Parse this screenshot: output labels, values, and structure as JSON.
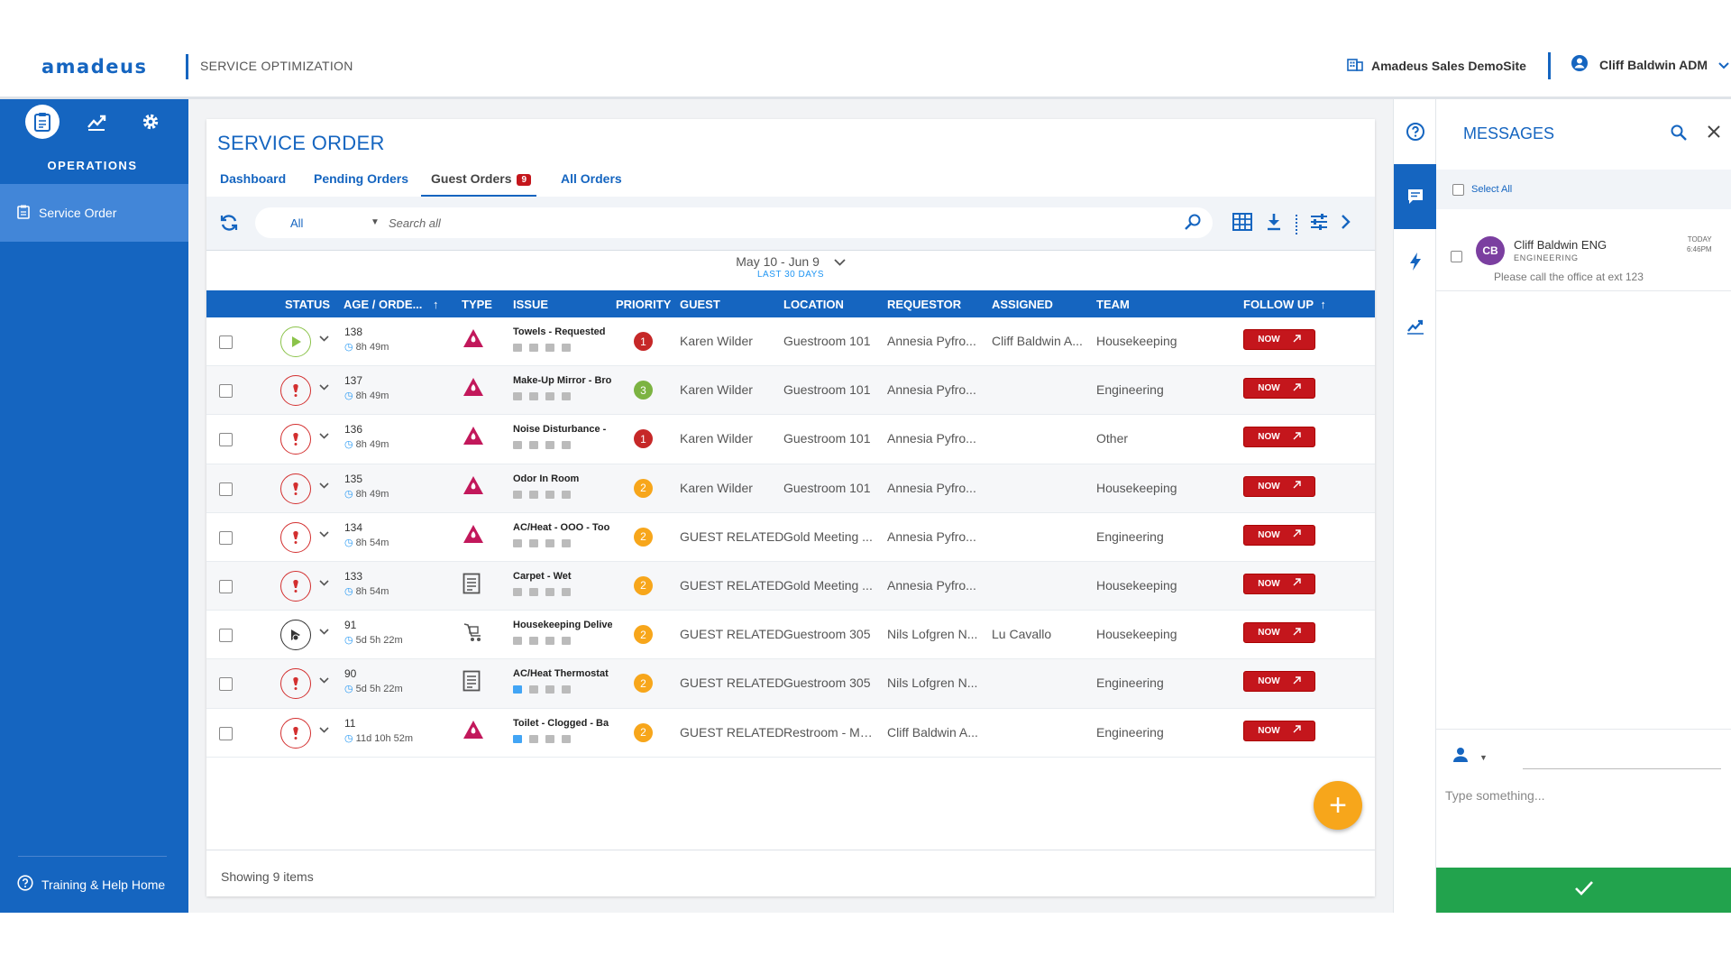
{
  "header": {
    "logo": "amadeus",
    "app_title": "SERVICE OPTIMIZATION",
    "site_name": "Amadeus Sales DemoSite",
    "user_name": "Cliff Baldwin ADM"
  },
  "nav": {
    "section_title": "OPERATIONS",
    "items": [
      {
        "label": "Service Order"
      }
    ],
    "help_label": "Training & Help Home"
  },
  "page": {
    "title": "SERVICE ORDER",
    "tabs": [
      {
        "label": "Dashboard"
      },
      {
        "label": "Pending Orders"
      },
      {
        "label": "Guest Orders",
        "badge": "9"
      },
      {
        "label": "All Orders"
      }
    ],
    "active_tab": "Guest Orders"
  },
  "toolbar": {
    "filter_value": "All",
    "search_placeholder": "Search all"
  },
  "date_range": {
    "range": "May 10 - Jun 9",
    "caption": "LAST 30 DAYS"
  },
  "table": {
    "columns": [
      "STATUS",
      "AGE / ORDE...",
      "TYPE",
      "ISSUE",
      "PRIORITY",
      "GUEST",
      "LOCATION",
      "REQUESTOR",
      "ASSIGNED",
      "TEAM",
      "FOLLOW UP"
    ],
    "sort_arrow": "↑",
    "follow_label": "NOW",
    "rows": [
      {
        "status": "play",
        "order": "138",
        "age": "8h 49m",
        "type": "alert",
        "issue": "Towels - Requested",
        "priority": "1",
        "guest": "Karen Wilder",
        "location": "Guestroom 101",
        "requestor": "Annesia Pyfro...",
        "assigned": "Cliff Baldwin A...",
        "team": "Housekeeping"
      },
      {
        "status": "alert",
        "order": "137",
        "age": "8h 49m",
        "type": "alert",
        "issue": "Make-Up Mirror - Broken",
        "priority": "3",
        "guest": "Karen Wilder",
        "location": "Guestroom 101",
        "requestor": "Annesia Pyfro...",
        "assigned": "",
        "team": "Engineering"
      },
      {
        "status": "alert",
        "order": "136",
        "age": "8h 49m",
        "type": "alert",
        "issue": "Noise Disturbance - ",
        "priority": "1",
        "guest": "Karen Wilder",
        "location": "Guestroom 101",
        "requestor": "Annesia Pyfro...",
        "assigned": "",
        "team": "Other"
      },
      {
        "status": "alert",
        "order": "135",
        "age": "8h 49m",
        "type": "alert",
        "issue": "Odor In Room",
        "priority": "2",
        "guest": "Karen Wilder",
        "location": "Guestroom 101",
        "requestor": "Annesia Pyfro...",
        "assigned": "",
        "team": "Housekeeping"
      },
      {
        "status": "alert",
        "order": "134",
        "age": "8h 54m",
        "type": "alert",
        "issue": "AC/Heat - OOO - Too",
        "priority": "2",
        "guest": "GUEST RELATED",
        "location": "Gold Meeting ...",
        "requestor": "Annesia Pyfro...",
        "assigned": "",
        "team": "Engineering"
      },
      {
        "status": "alert",
        "order": "133",
        "age": "8h 54m",
        "type": "doc",
        "issue": "Carpet - Wet",
        "priority": "2",
        "guest": "GUEST RELATED",
        "location": "Gold Meeting ...",
        "requestor": "Annesia Pyfro...",
        "assigned": "",
        "team": "Housekeeping"
      },
      {
        "status": "delivered",
        "order": "91",
        "age": "5d 5h 22m",
        "type": "cart",
        "issue": "Housekeeping Delivery",
        "priority": "2",
        "guest": "GUEST RELATED",
        "location": "Guestroom 305",
        "requestor": "Nils Lofgren N...",
        "assigned": "Lu Cavallo",
        "team": "Housekeeping"
      },
      {
        "status": "alert",
        "order": "90",
        "age": "5d 5h 22m",
        "type": "doc",
        "issue": "AC/Heat Thermostat",
        "priority": "2",
        "guest": "GUEST RELATED",
        "location": "Guestroom 305",
        "requestor": "Nils Lofgren N...",
        "assigned": "",
        "team": "Engineering"
      },
      {
        "status": "alert",
        "order": "11",
        "age": "11d 10h 52m",
        "type": "alert",
        "issue": "Toilet - Clogged - Ba",
        "priority": "2",
        "guest": "GUEST RELATED",
        "location": "Restroom - Me...",
        "requestor": "Cliff Baldwin A...",
        "assigned": "",
        "team": "Engineering"
      }
    ],
    "footer": "Showing 9 items"
  },
  "messages": {
    "title": "MESSAGES",
    "select_all": "Select All",
    "items": [
      {
        "initials": "CB",
        "name": "Cliff Baldwin ENG",
        "team": "ENGINEERING",
        "time_day": "TODAY",
        "time": "6:46PM",
        "text": "Please call the office at ext 123"
      }
    ],
    "input_placeholder": "Type something..."
  },
  "colors": {
    "brand_blue": "#1565c0",
    "alert_red": "#c4161c",
    "priority_1": "#c62828",
    "priority_2": "#f7a61b",
    "priority_3": "#7cb342",
    "send_green": "#22a34d",
    "fab_orange": "#f7a61b"
  }
}
